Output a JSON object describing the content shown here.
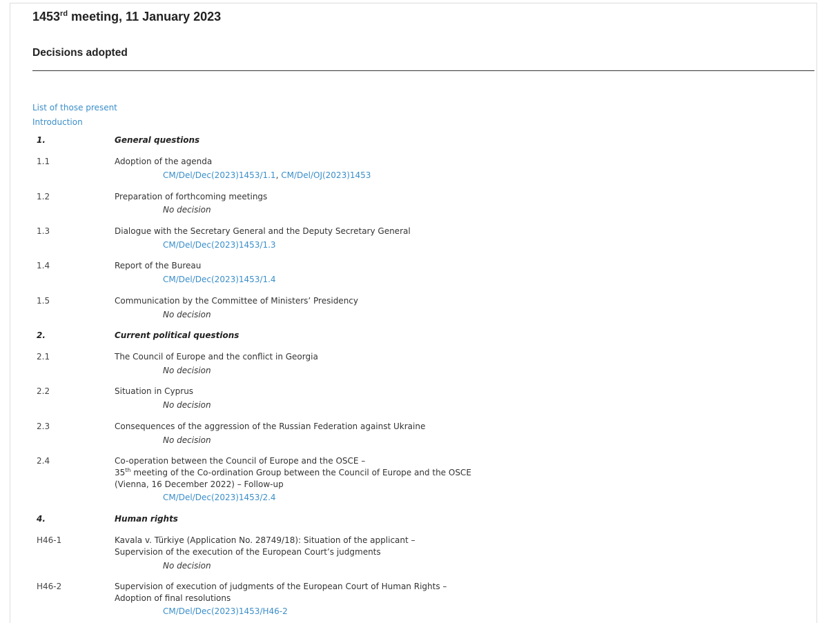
{
  "title": {
    "number": "1453",
    "suffix": "rd",
    "rest": " meeting, 11 January 2023"
  },
  "subtitle": "Decisions adopted",
  "links": {
    "present": "List of those present",
    "introduction": "Introduction"
  },
  "sections": {
    "s1": {
      "num": "1.",
      "title": "General questions"
    },
    "s2": {
      "num": "2.",
      "title": "Current political questions"
    },
    "s4": {
      "num": "4.",
      "title": "Human rights"
    }
  },
  "items": {
    "i11": {
      "num": "1.1",
      "text": "Adoption of the agenda",
      "ref1": "CM/Del/Dec(2023)1453/1.1",
      "sep": ", ",
      "ref2": "CM/Del/OJ(2023)1453"
    },
    "i12": {
      "num": "1.2",
      "text": "Preparation of forthcoming meetings",
      "decision": "No decision"
    },
    "i13": {
      "num": "1.3",
      "text": "Dialogue with the Secretary General and the Deputy Secretary General",
      "ref1": "CM/Del/Dec(2023)1453/1.3"
    },
    "i14": {
      "num": "1.4",
      "text": "Report of the Bureau",
      "ref1": "CM/Del/Dec(2023)1453/1.4"
    },
    "i15": {
      "num": "1.5",
      "text": "Communication by the Committee of Ministers’ Presidency",
      "decision": "No decision"
    },
    "i21": {
      "num": "2.1",
      "text": "The Council of Europe and the conflict in Georgia",
      "decision": "No decision"
    },
    "i22": {
      "num": "2.2",
      "text": "Situation in Cyprus",
      "decision": "No decision"
    },
    "i23": {
      "num": "2.3",
      "text": "Consequences of the aggression of the Russian Federation against Ukraine",
      "decision": "No decision"
    },
    "i24": {
      "num": "2.4",
      "line1": "Co-operation between the Council of Europe and the OSCE –",
      "line2_num": "35",
      "line2_sup": "th",
      "line2_rest": " meeting of the Co-ordination Group between the Council of Europe and the OSCE",
      "line3": "(Vienna, 16 December 2022) – Follow-up",
      "ref1": "CM/Del/Dec(2023)1453/2.4"
    },
    "h1": {
      "num": "H46-1",
      "line1": "Kavala v. Türkiye (Application No. 28749/18): Situation of the applicant –",
      "line2": "Supervision of the execution of the European Court’s judgments",
      "decision": "No decision"
    },
    "h2": {
      "num": "H46-2",
      "line1": "Supervision of execution of judgments of the European Court of Human Rights –",
      "line2": "Adoption of final resolutions",
      "ref1": "CM/Del/Dec(2023)1453/H46-2"
    }
  },
  "colors": {
    "link": "#3a8ec9",
    "text": "#333333",
    "rule": "#333333"
  }
}
